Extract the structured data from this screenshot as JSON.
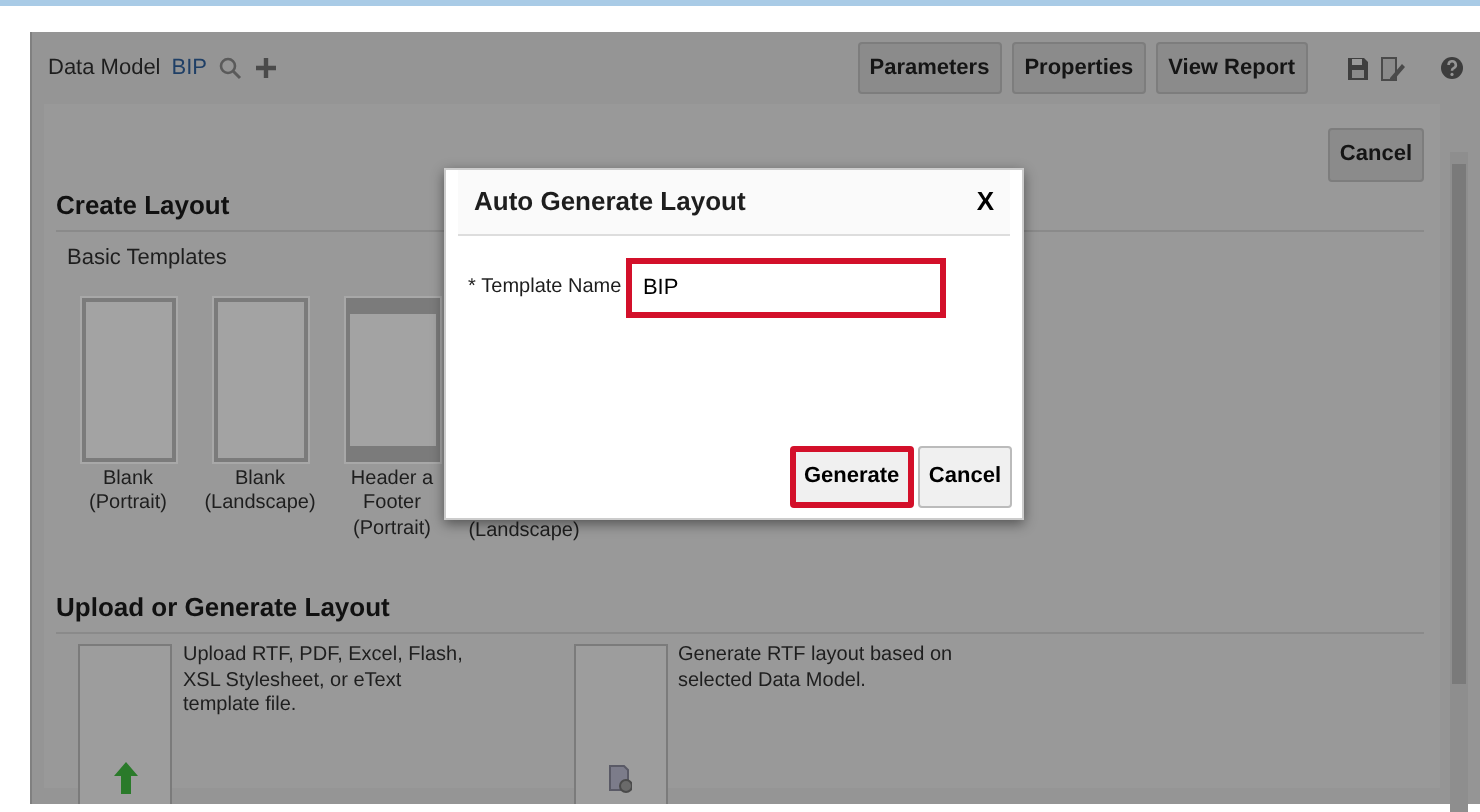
{
  "toolbar": {
    "title": "Data Model",
    "model_link": "BIP",
    "buttons": [
      "Parameters",
      "Properties",
      "View Report"
    ]
  },
  "cancel_button": "Cancel",
  "create_layout": {
    "heading": "Create Layout",
    "subheading": "Basic Templates",
    "templates": [
      {
        "kind": "blank",
        "label": [
          "Blank",
          "(Portrait)"
        ]
      },
      {
        "kind": "blank",
        "label": [
          "Blank",
          "(Landscape)"
        ]
      },
      {
        "kind": "header-footer",
        "label": [
          "Header a",
          "Footer",
          "(Portrait)"
        ]
      },
      {
        "kind": "covered",
        "label": [
          "(Landscape)"
        ]
      }
    ]
  },
  "upload_section": {
    "heading": "Upload or Generate Layout",
    "options": [
      {
        "kind": "upload",
        "text": "Upload RTF, PDF, Excel, Flash, XSL Stylesheet, or eText template file."
      },
      {
        "kind": "generate",
        "text": "Generate RTF layout based on selected Data Model."
      }
    ]
  },
  "dialog": {
    "title": "Auto Generate Layout",
    "close": "X",
    "field": {
      "required_mark": "*",
      "label": "Template Name",
      "value": "BIP",
      "highlighted": true
    },
    "buttons": [
      {
        "label": "Generate",
        "highlighted": true
      },
      {
        "label": "Cancel",
        "highlighted": false
      }
    ]
  }
}
